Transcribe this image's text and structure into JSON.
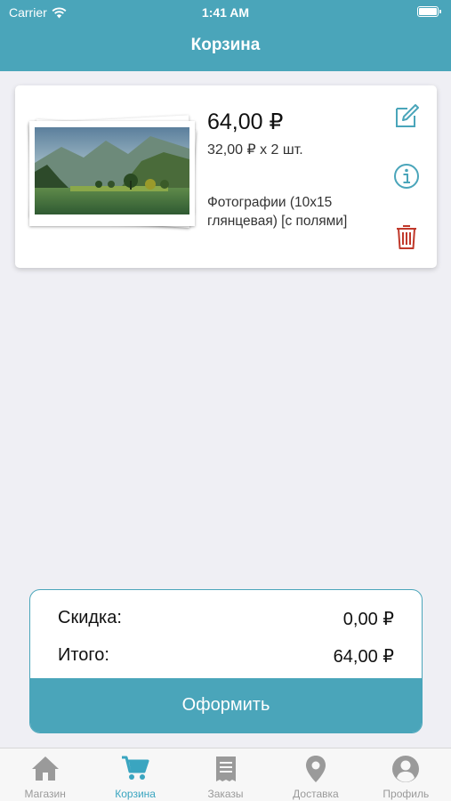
{
  "status_bar": {
    "carrier": "Carrier",
    "time": "1:41 AM"
  },
  "header": {
    "title": "Корзина"
  },
  "cart_item": {
    "total_price": "64,00 ₽",
    "unit_price": "32,00 ₽ x 2 шт.",
    "description": "Фотографии (10x15 глянцевая) [с полями]",
    "quantity": 2
  },
  "summary": {
    "discount_label": "Скидка:",
    "discount_value": "0,00 ₽",
    "total_label": "Итого:",
    "total_value": "64,00 ₽",
    "checkout_label": "Оформить"
  },
  "tabs": [
    {
      "label": "Магазин",
      "icon": "home-icon",
      "active": false
    },
    {
      "label": "Корзина",
      "icon": "cart-icon",
      "active": true
    },
    {
      "label": "Заказы",
      "icon": "orders-icon",
      "active": false
    },
    {
      "label": "Доставка",
      "icon": "location-pin-icon",
      "active": false
    },
    {
      "label": "Профиль",
      "icon": "profile-icon",
      "active": false
    }
  ],
  "colors": {
    "accent": "#4aa5ba",
    "tab_active": "#3aa5c0",
    "delete": "#c0392b"
  }
}
